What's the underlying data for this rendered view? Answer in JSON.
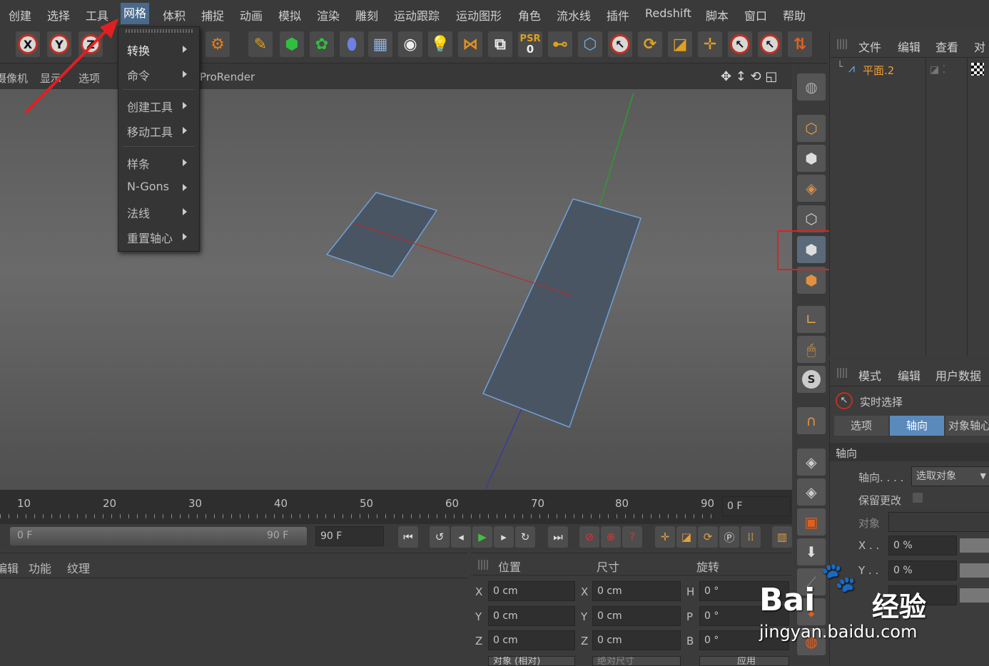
{
  "menubar": {
    "items": [
      "创建",
      "选择",
      "工具",
      "网格",
      "体积",
      "捕捉",
      "动画",
      "模拟",
      "渲染",
      "雕刻",
      "运动跟踪",
      "运动图形",
      "角色",
      "流水线",
      "插件",
      "Redshift",
      "脚本",
      "窗口",
      "帮助"
    ],
    "active": "网格"
  },
  "dropdown": {
    "items": [
      "转换",
      "命令",
      "创建工具",
      "移动工具",
      "样条",
      "N-Gons",
      "法线",
      "重置轴心"
    ]
  },
  "toolbar": {
    "x_label": "X",
    "y_label": "Y",
    "z_label": "Z",
    "psr_label": "PSR",
    "psr_value": "0"
  },
  "viewport": {
    "menu": [
      "摄像机",
      "显示",
      "选项"
    ],
    "renderer": "ProRender"
  },
  "object_manager": {
    "tabs": [
      "文件",
      "编辑",
      "查看",
      "对"
    ],
    "object_name": "平面.2"
  },
  "attribute_manager": {
    "tabs": [
      "模式",
      "编辑",
      "用户数据"
    ],
    "tool_name": "实时选择",
    "subtabs": [
      "选项",
      "轴向",
      "对象轴心"
    ],
    "active_subtab": "轴向",
    "section_title": "轴向",
    "axis_label": "轴向. . . .",
    "axis_value": "选取对象",
    "keep_changes_label": "保留更改",
    "object_label": "对象",
    "x_label": "X . .",
    "x_value": "0 %",
    "y_label": "Y . .",
    "y_value": "0 %"
  },
  "timeline": {
    "ticks": [
      "10",
      "20",
      "30",
      "40",
      "50",
      "60",
      "70",
      "80",
      "90"
    ],
    "current_frame": "0 F",
    "range_start": "0 F",
    "range_end": "90 F",
    "end_frame": "90 F"
  },
  "material_manager": {
    "menu": [
      "编辑",
      "功能",
      "纹理"
    ]
  },
  "coordinates": {
    "headers": [
      "位置",
      "尺寸",
      "旋转"
    ],
    "rows": [
      {
        "axis": "X",
        "pos": "0 cm",
        "size_axis": "X",
        "size": "0 cm",
        "rot_axis": "H",
        "rot": "0 °"
      },
      {
        "axis": "Y",
        "pos": "0 cm",
        "size_axis": "Y",
        "size": "0 cm",
        "rot_axis": "P",
        "rot": "0 °"
      },
      {
        "axis": "Z",
        "pos": "0 cm",
        "size_axis": "Z",
        "size": "0 cm",
        "rot_axis": "B",
        "rot": "0 °"
      }
    ],
    "mode_value": "对象 (相对)",
    "size_mode_value": "绝对尺寸",
    "apply_label": "应用"
  },
  "watermark": {
    "brand": "Bai",
    "brand_suffix": "经验",
    "url": "jingyan.baidu.com"
  },
  "colors": {
    "accent": "#4a6a8c",
    "annotation_red": "#e02020",
    "plane_fill": "#4a5563",
    "plane_edge": "#6fa0d8"
  }
}
